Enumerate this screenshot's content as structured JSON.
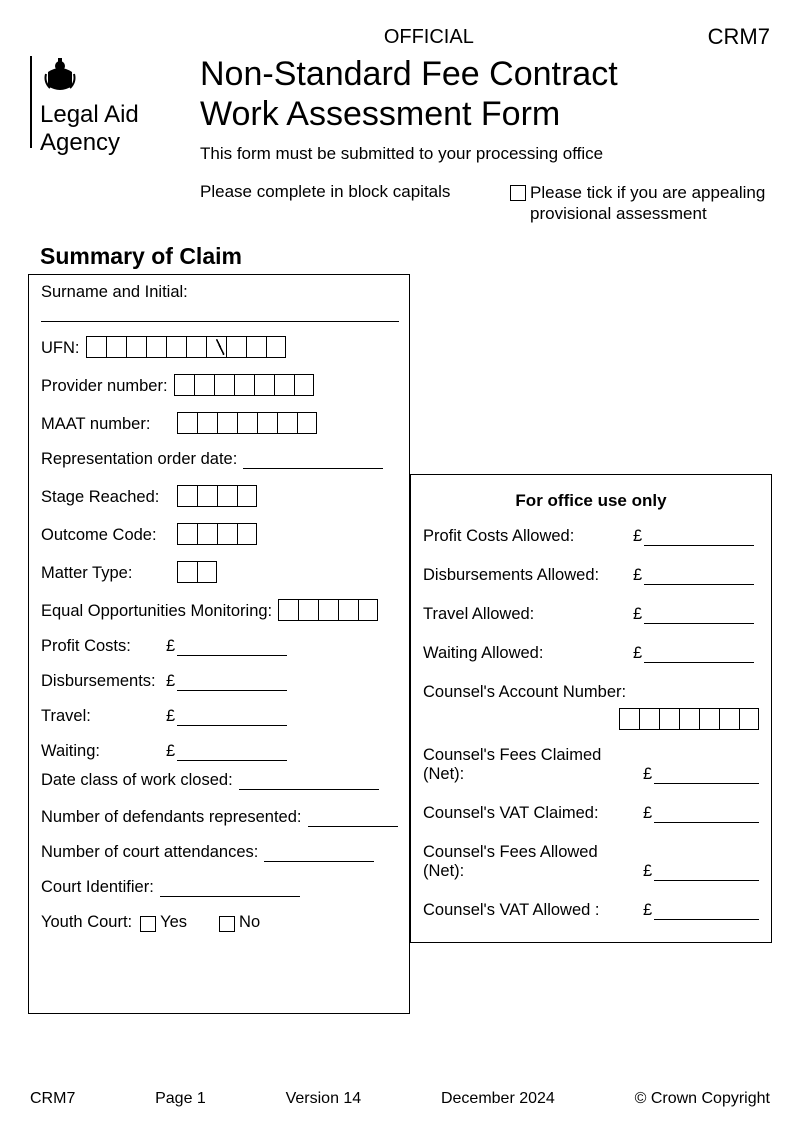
{
  "header": {
    "classification": "OFFICIAL",
    "form_code": "CRM7",
    "agency_line1": "Legal Aid",
    "agency_line2": "Agency",
    "title_line1": "Non-Standard Fee Contract",
    "title_line2": "Work Assessment Form",
    "subtitle": "This form must be submitted to your processing office",
    "instruction_left": "Please complete in block capitals",
    "appeal_text": "Please tick if you are appealing provisional assessment"
  },
  "section_title": "Summary of Claim",
  "left": {
    "surname_label": "Surname and Initial:",
    "ufn_label": "UFN:",
    "provider_label": "Provider number:",
    "maat_label": "MAAT number:",
    "rep_order_label": "Representation order date:",
    "stage_label": "Stage Reached:",
    "outcome_label": "Outcome Code:",
    "matter_label": "Matter Type:",
    "eom_label": "Equal Opportunities Monitoring:",
    "profit_label": "Profit Costs:",
    "disb_label": "Disbursements:",
    "travel_label": "Travel:",
    "waiting_label": "Waiting:",
    "date_closed_label": "Date class of work closed:",
    "num_def_label": "Number of defendants represented:",
    "num_court_label": "Number of court attendances:",
    "court_id_label": "Court Identifier:",
    "youth_label": "Youth Court:",
    "yes": "Yes",
    "no": "No"
  },
  "right": {
    "title": "For office use only",
    "profit_allowed": "Profit Costs Allowed:",
    "disb_allowed": "Disbursements Allowed:",
    "travel_allowed": "Travel Allowed:",
    "waiting_allowed": "Waiting Allowed:",
    "counsel_acct": "Counsel's Account Number:",
    "counsel_fees_claimed": "Counsel's Fees Claimed (Net):",
    "counsel_vat_claimed": "Counsel's VAT Claimed:",
    "counsel_fees_allowed": "Counsel's Fees Allowed (Net):",
    "counsel_vat_allowed": "Counsel's VAT Allowed :"
  },
  "footer": {
    "form_code": "CRM7",
    "page": "Page 1",
    "version": "Version 14",
    "date": "December 2024",
    "copyright": "© Crown Copyright"
  },
  "currency": "£"
}
